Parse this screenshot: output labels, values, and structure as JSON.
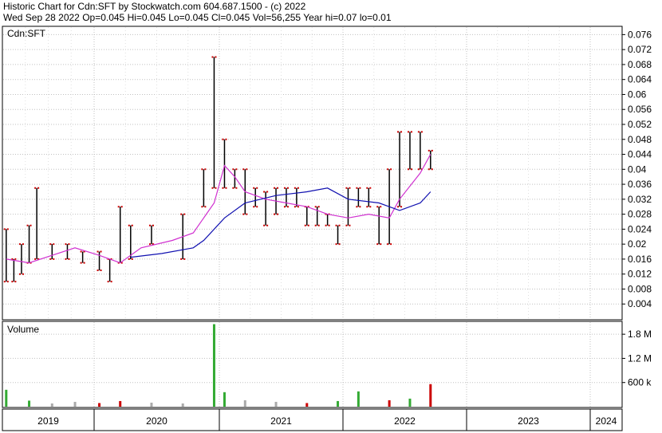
{
  "header": {
    "line1": "Historic Chart for Cdn:SFT by Stockwatch.com 604.687.1500 - (c) 2022",
    "line2": "Wed Sep 28 2022   Op=0.045   Hi=0.045   Lo=0.045   Cl=0.045   Vol=56,255   Year hi=0.07   lo=0.01"
  },
  "colors": {
    "up_bar": "#000000",
    "down_tick": "#cc0000",
    "ma_short": "#d030d0",
    "ma_long": "#1010b0",
    "vol_up": "#33aa33",
    "vol_down": "#cc0000",
    "vol_flat": "#aaaaaa",
    "grid": "#c0c0c0"
  },
  "chart_data": [
    {
      "type": "line",
      "title": "Cdn:SFT",
      "panel_label": "Cdn:SFT",
      "ylim": [
        0,
        0.078
      ],
      "y_ticks": [
        "0.076",
        "0.072",
        "0.068",
        "0.064",
        "0.06",
        "0.056",
        "0.052",
        "0.048",
        "0.044",
        "0.04",
        "0.036",
        "0.032",
        "0.028",
        "0.024",
        "0.02",
        "0.016",
        "0.012",
        "0.008",
        "0.004"
      ],
      "x_labels": [
        "2019",
        "2020",
        "2021",
        "2022",
        "2023",
        "2024"
      ],
      "series": [
        {
          "kind": "price_ranges",
          "points": [
            {
              "x": "2019-01",
              "lo": 0.01,
              "hi": 0.024
            },
            {
              "x": "2019-02",
              "lo": 0.01,
              "hi": 0.016
            },
            {
              "x": "2019-03",
              "lo": 0.012,
              "hi": 0.02
            },
            {
              "x": "2019-04",
              "lo": 0.015,
              "hi": 0.025
            },
            {
              "x": "2019-05",
              "lo": 0.016,
              "hi": 0.035
            },
            {
              "x": "2019-07",
              "lo": 0.016,
              "hi": 0.02
            },
            {
              "x": "2019-09",
              "lo": 0.016,
              "hi": 0.02
            },
            {
              "x": "2019-11",
              "lo": 0.015,
              "hi": 0.018
            },
            {
              "x": "2020-01",
              "lo": 0.013,
              "hi": 0.018
            },
            {
              "x": "2020-02",
              "lo": 0.01,
              "hi": 0.016
            },
            {
              "x": "2020-03",
              "lo": 0.015,
              "hi": 0.03
            },
            {
              "x": "2020-04",
              "lo": 0.016,
              "hi": 0.025
            },
            {
              "x": "2020-06",
              "lo": 0.02,
              "hi": 0.025
            },
            {
              "x": "2020-09",
              "lo": 0.016,
              "hi": 0.028
            },
            {
              "x": "2020-11",
              "lo": 0.03,
              "hi": 0.04
            },
            {
              "x": "2020-12",
              "lo": 0.035,
              "hi": 0.07
            },
            {
              "x": "2021-01",
              "lo": 0.035,
              "hi": 0.048
            },
            {
              "x": "2021-02",
              "lo": 0.035,
              "hi": 0.04
            },
            {
              "x": "2021-03",
              "lo": 0.028,
              "hi": 0.04
            },
            {
              "x": "2021-04",
              "lo": 0.03,
              "hi": 0.035
            },
            {
              "x": "2021-05",
              "lo": 0.025,
              "hi": 0.034
            },
            {
              "x": "2021-06",
              "lo": 0.028,
              "hi": 0.035
            },
            {
              "x": "2021-07",
              "lo": 0.03,
              "hi": 0.035
            },
            {
              "x": "2021-08",
              "lo": 0.03,
              "hi": 0.035
            },
            {
              "x": "2021-09",
              "lo": 0.025,
              "hi": 0.03
            },
            {
              "x": "2021-10",
              "lo": 0.025,
              "hi": 0.03
            },
            {
              "x": "2021-11",
              "lo": 0.025,
              "hi": 0.028
            },
            {
              "x": "2021-12",
              "lo": 0.02,
              "hi": 0.025
            },
            {
              "x": "2022-01",
              "lo": 0.025,
              "hi": 0.035
            },
            {
              "x": "2022-02",
              "lo": 0.03,
              "hi": 0.035
            },
            {
              "x": "2022-03",
              "lo": 0.03,
              "hi": 0.035
            },
            {
              "x": "2022-04",
              "lo": 0.02,
              "hi": 0.03
            },
            {
              "x": "2022-05",
              "lo": 0.02,
              "hi": 0.04
            },
            {
              "x": "2022-06",
              "lo": 0.03,
              "hi": 0.05
            },
            {
              "x": "2022-07",
              "lo": 0.04,
              "hi": 0.05
            },
            {
              "x": "2022-08",
              "lo": 0.04,
              "hi": 0.05
            },
            {
              "x": "2022-09",
              "lo": 0.04,
              "hi": 0.045
            }
          ]
        },
        {
          "kind": "moving_average_short",
          "points": [
            {
              "x": "2019-01",
              "y": 0.016
            },
            {
              "x": "2019-04",
              "y": 0.015
            },
            {
              "x": "2019-07",
              "y": 0.017
            },
            {
              "x": "2019-10",
              "y": 0.019
            },
            {
              "x": "2020-01",
              "y": 0.017
            },
            {
              "x": "2020-03",
              "y": 0.015
            },
            {
              "x": "2020-05",
              "y": 0.019
            },
            {
              "x": "2020-08",
              "y": 0.021
            },
            {
              "x": "2020-10",
              "y": 0.023
            },
            {
              "x": "2020-12",
              "y": 0.031
            },
            {
              "x": "2021-01",
              "y": 0.041
            },
            {
              "x": "2021-02",
              "y": 0.038
            },
            {
              "x": "2021-03",
              "y": 0.034
            },
            {
              "x": "2021-05",
              "y": 0.032
            },
            {
              "x": "2021-07",
              "y": 0.031
            },
            {
              "x": "2021-09",
              "y": 0.03
            },
            {
              "x": "2021-11",
              "y": 0.028
            },
            {
              "x": "2022-01",
              "y": 0.027
            },
            {
              "x": "2022-03",
              "y": 0.028
            },
            {
              "x": "2022-05",
              "y": 0.027
            },
            {
              "x": "2022-06",
              "y": 0.032
            },
            {
              "x": "2022-08",
              "y": 0.039
            },
            {
              "x": "2022-09",
              "y": 0.044
            }
          ]
        },
        {
          "kind": "moving_average_long",
          "points": [
            {
              "x": "2020-04",
              "y": 0.0165
            },
            {
              "x": "2020-07",
              "y": 0.0175
            },
            {
              "x": "2020-10",
              "y": 0.019
            },
            {
              "x": "2020-11",
              "y": 0.021
            },
            {
              "x": "2021-01",
              "y": 0.027
            },
            {
              "x": "2021-03",
              "y": 0.031
            },
            {
              "x": "2021-06",
              "y": 0.033
            },
            {
              "x": "2021-09",
              "y": 0.034
            },
            {
              "x": "2021-11",
              "y": 0.035
            },
            {
              "x": "2022-01",
              "y": 0.032
            },
            {
              "x": "2022-04",
              "y": 0.031
            },
            {
              "x": "2022-06",
              "y": 0.029
            },
            {
              "x": "2022-08",
              "y": 0.031
            },
            {
              "x": "2022-09",
              "y": 0.034
            }
          ]
        }
      ]
    },
    {
      "type": "bar",
      "title": "Volume",
      "panel_label": "Volume",
      "ylim": [
        0,
        2100000
      ],
      "y_ticks": [
        "1.8 M",
        "1.2 M",
        "600 k"
      ],
      "notable_values": [
        {
          "x": "2019-01",
          "value": 420000,
          "dir": "up"
        },
        {
          "x": "2019-04",
          "value": 150000,
          "dir": "up"
        },
        {
          "x": "2019-07",
          "value": 80000,
          "dir": "flat"
        },
        {
          "x": "2019-10",
          "value": 120000,
          "dir": "flat"
        },
        {
          "x": "2020-01",
          "value": 90000,
          "dir": "down"
        },
        {
          "x": "2020-03",
          "value": 140000,
          "dir": "down"
        },
        {
          "x": "2020-06",
          "value": 100000,
          "dir": "flat"
        },
        {
          "x": "2020-09",
          "value": 80000,
          "dir": "flat"
        },
        {
          "x": "2020-12",
          "value": 2050000,
          "dir": "up"
        },
        {
          "x": "2021-01",
          "value": 360000,
          "dir": "up"
        },
        {
          "x": "2021-03",
          "value": 160000,
          "dir": "flat"
        },
        {
          "x": "2021-06",
          "value": 120000,
          "dir": "flat"
        },
        {
          "x": "2021-09",
          "value": 90000,
          "dir": "down"
        },
        {
          "x": "2021-12",
          "value": 140000,
          "dir": "up"
        },
        {
          "x": "2022-02",
          "value": 380000,
          "dir": "up"
        },
        {
          "x": "2022-05",
          "value": 160000,
          "dir": "down"
        },
        {
          "x": "2022-07",
          "value": 200000,
          "dir": "up"
        },
        {
          "x": "2022-09",
          "value": 560000,
          "dir": "down"
        }
      ]
    }
  ]
}
